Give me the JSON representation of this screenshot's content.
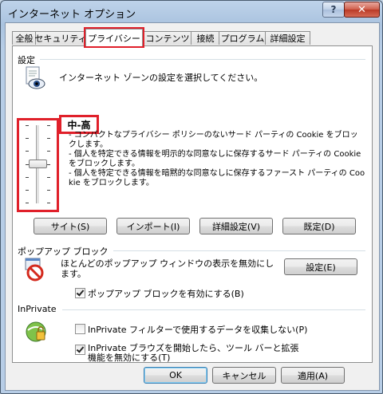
{
  "window": {
    "title": "インターネット オプション",
    "help_label": "?",
    "close_label": "✕"
  },
  "tabs": [
    {
      "label": "全般"
    },
    {
      "label": "セキュリティ"
    },
    {
      "label": "プライバシー",
      "active": true
    },
    {
      "label": "コンテンツ"
    },
    {
      "label": "接続"
    },
    {
      "label": "プログラム"
    },
    {
      "label": "詳細設定"
    }
  ],
  "settings": {
    "group_label": "設定",
    "instruction": "インターネット ゾーンの設定を選択してください。",
    "level": "中-高",
    "slider_level_fraction": 0.5,
    "description": [
      "- コンパクトなプライバシー ポリシーのないサード パーティの Cookie をブロックします。",
      "- 個人を特定できる情報を明示的な同意なしに保存するサード パーティの Cookie をブロックします。",
      "- 個人を特定できる情報を暗黙的な同意なしに保存するファースト パーティの Cookie をブロックします。"
    ],
    "buttons": {
      "sites": "サイト(S)",
      "import": "インポート(I)",
      "advanced": "詳細設定(V)",
      "default": "既定(D)"
    }
  },
  "popup": {
    "group_label": "ポップアップ ブロック",
    "description": "ほとんどのポップアップ ウィンドウの表示を無効にします。",
    "settings_button": "設定(E)",
    "enable_label": "ポップアップ ブロックを有効にする(B)",
    "enable_checked": true
  },
  "inprivate": {
    "group_label": "InPrivate",
    "filter_label": "InPrivate フィルターで使用するデータを収集しない(P)",
    "filter_checked": false,
    "disable_toolbars_label": "InPrivate ブラウズを開始したら、ツール バーと拡張機能を無効にする(T)",
    "disable_toolbars_checked": true
  },
  "footer": {
    "ok": "OK",
    "cancel": "キャンセル",
    "apply": "適用(A)"
  },
  "colors": {
    "highlight_box": "#e0202a",
    "titlebar": "#b7cde6"
  }
}
